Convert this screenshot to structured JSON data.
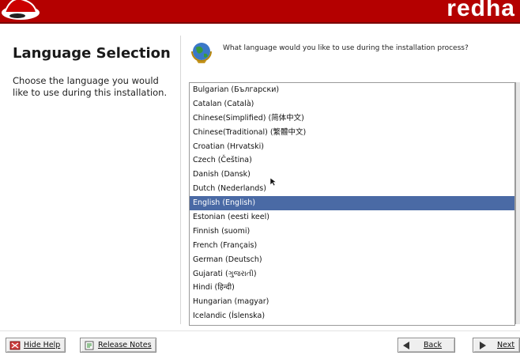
{
  "header": {
    "brand": "redha"
  },
  "help": {
    "title": "Language Selection",
    "text": "Choose the language you would like to use during this installation."
  },
  "question": "What language would you like to use during the installation process?",
  "languages": [
    "Bulgarian (Български)",
    "Catalan (Català)",
    "Chinese(Simplified) (简体中文)",
    "Chinese(Traditional) (繁體中文)",
    "Croatian (Hrvatski)",
    "Czech (Čeština)",
    "Danish (Dansk)",
    "Dutch (Nederlands)",
    "English (English)",
    "Estonian (eesti keel)",
    "Finnish (suomi)",
    "French (Français)",
    "German (Deutsch)",
    "Gujarati (ગુજરાતી)",
    "Hindi (हिन्दी)",
    "Hungarian (magyar)",
    "Icelandic (Íslenska)"
  ],
  "selected_language": "English (English)",
  "buttons": {
    "hide_help": "Hide Help",
    "release_notes": "Release Notes",
    "back": "Back",
    "next": "Next"
  },
  "colors": {
    "banner": "#b40000",
    "selection": "#4a6aa5"
  }
}
